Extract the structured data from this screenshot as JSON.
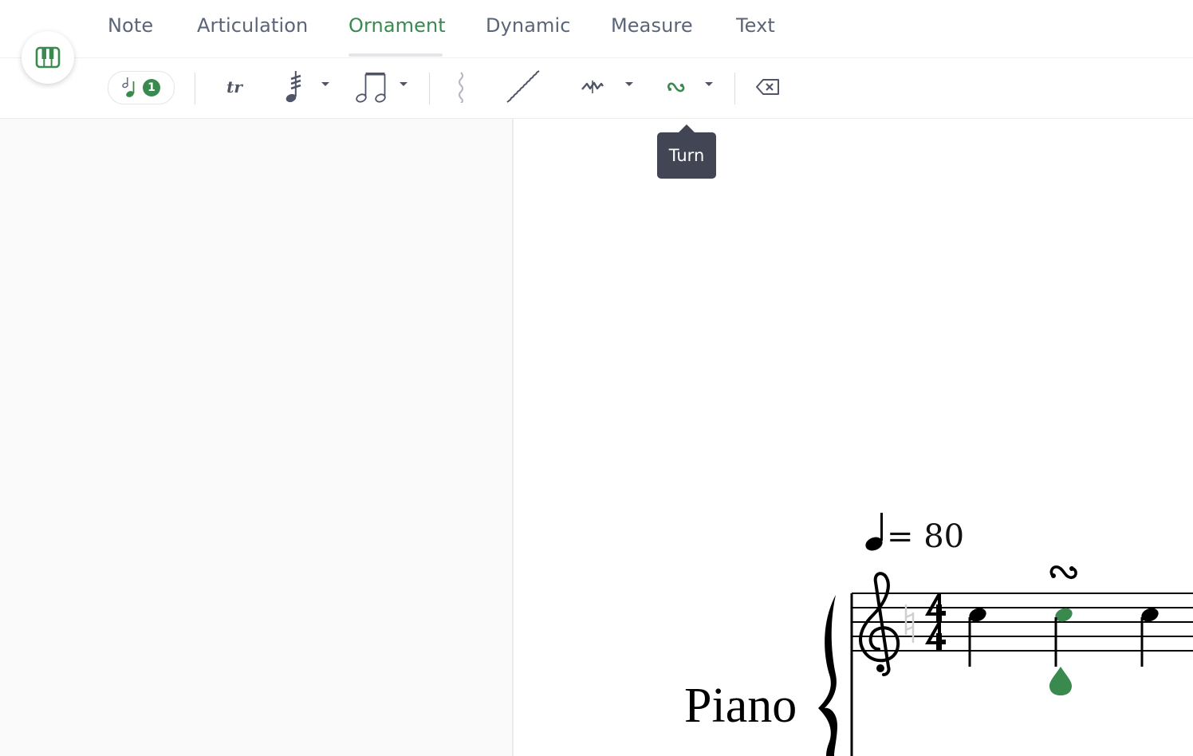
{
  "tabs": [
    {
      "label": "Note",
      "active": false
    },
    {
      "label": "Articulation",
      "active": false
    },
    {
      "label": "Ornament",
      "active": true
    },
    {
      "label": "Dynamic",
      "active": false
    },
    {
      "label": "Measure",
      "active": false
    },
    {
      "label": "Text",
      "active": false
    }
  ],
  "colors": {
    "accent": "#3a8a4f",
    "text": "#5b6578",
    "tooltip_bg": "#414554"
  },
  "toolbar": {
    "selected_note_count": "1",
    "tools": [
      {
        "icon": "grace-note-icon"
      },
      {
        "icon": "trill-icon",
        "glyph": "tr"
      },
      {
        "icon": "tremolo-icon",
        "dropdown": true
      },
      {
        "icon": "beamed-notes-icon",
        "dropdown": true
      },
      {
        "icon": "arpeggio-icon"
      },
      {
        "icon": "glissando-icon"
      },
      {
        "icon": "mordent-icon",
        "dropdown": true
      },
      {
        "icon": "turn-icon",
        "dropdown": true,
        "active": true
      },
      {
        "icon": "delete-icon"
      }
    ]
  },
  "tooltip": {
    "text": "Turn"
  },
  "score": {
    "tempo": "= 80",
    "instrument": "Piano",
    "time_signature": "4/4",
    "ornament_glyph": "∾"
  }
}
